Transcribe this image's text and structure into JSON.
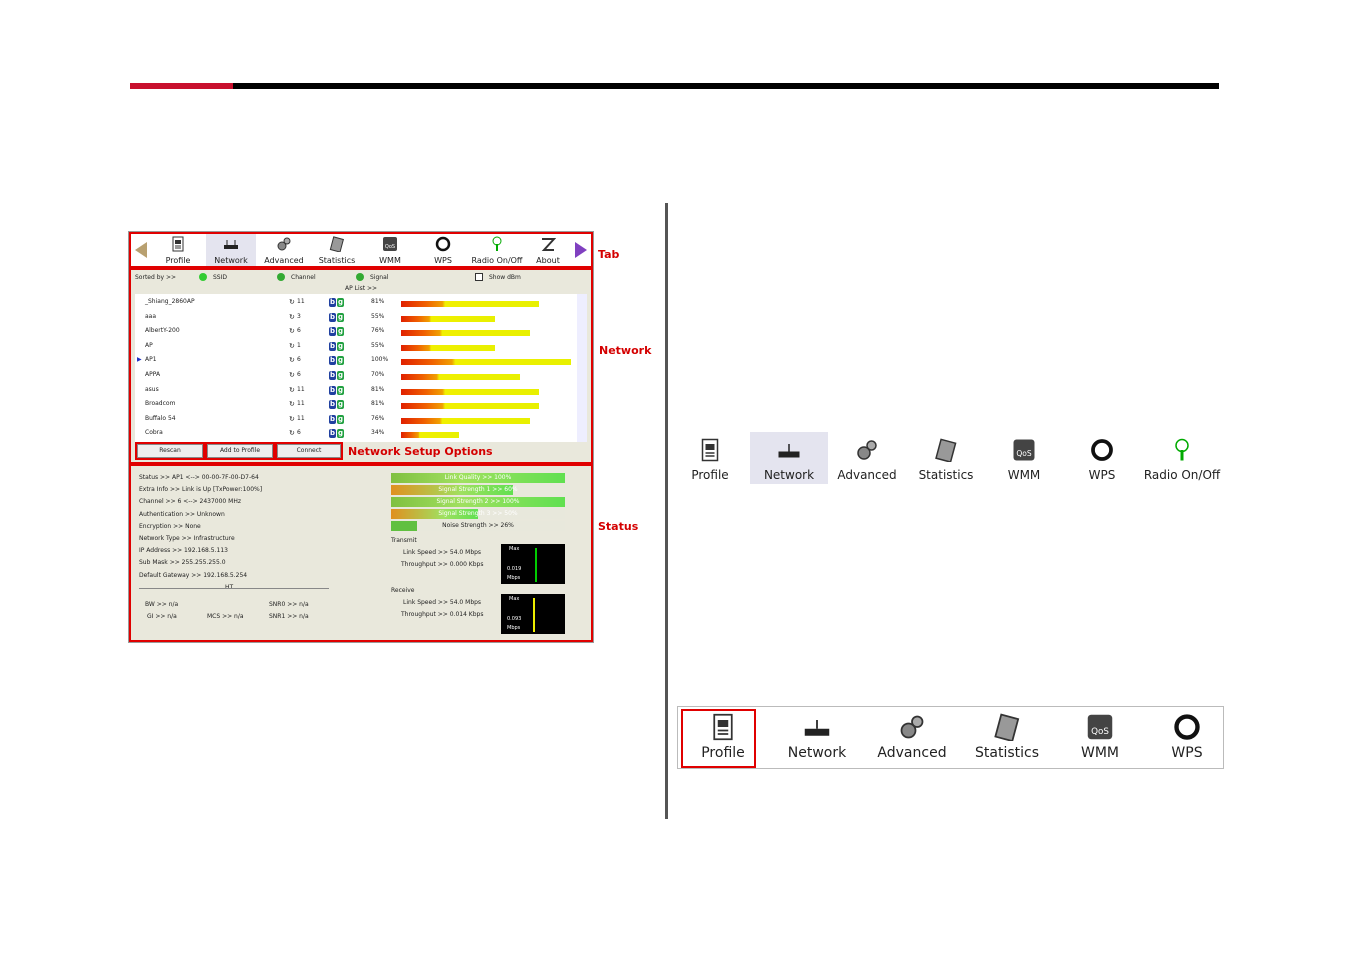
{
  "annotations": {
    "tab": "Tab",
    "network": "Network",
    "status": "Status",
    "setup": "Network Setup Options"
  },
  "tabs": [
    "Profile",
    "Network",
    "Advanced",
    "Statistics",
    "WMM",
    "WPS",
    "Radio On/Off",
    "About"
  ],
  "sort": {
    "label": "Sorted by >>",
    "ssid": "SSID",
    "channel": "Channel",
    "signal": "Signal",
    "show_dbm": "Show dBm",
    "ap_list": "AP List >>"
  },
  "aps": [
    {
      "name": "_Shiang_2860AP",
      "ch": "11",
      "pct": "81%",
      "fill": 0.81
    },
    {
      "name": "aaa",
      "ch": "3",
      "pct": "55%",
      "fill": 0.55
    },
    {
      "name": "AlbertY-200",
      "ch": "6",
      "pct": "76%",
      "fill": 0.76
    },
    {
      "name": "AP",
      "ch": "1",
      "pct": "55%",
      "fill": 0.55
    },
    {
      "name": "AP1",
      "ch": "6",
      "pct": "100%",
      "fill": 1.0
    },
    {
      "name": "APPA",
      "ch": "6",
      "pct": "70%",
      "fill": 0.7
    },
    {
      "name": "asus",
      "ch": "11",
      "pct": "81%",
      "fill": 0.81
    },
    {
      "name": "Broadcom",
      "ch": "11",
      "pct": "81%",
      "fill": 0.81
    },
    {
      "name": "Buffalo 54",
      "ch": "11",
      "pct": "76%",
      "fill": 0.76
    },
    {
      "name": "Cobra",
      "ch": "6",
      "pct": "34%",
      "fill": 0.34
    }
  ],
  "buttons": {
    "rescan": "Rescan",
    "add": "Add to Profile",
    "connect": "Connect"
  },
  "status": [
    "Status >> AP1 <--> 00-00-7F-00-D7-64",
    "Extra Info >> Link is Up [TxPower:100%]",
    "Channel >> 6 <--> 2437000 MHz",
    "Authentication >> Unknown",
    "Encryption >> None",
    "Network Type >> Infrastructure",
    "IP Address >> 192.168.5.113",
    "Sub Mask >> 255.255.255.0",
    "Default Gateway >> 192.168.5.254"
  ],
  "ht": {
    "label": "HT",
    "bw": "BW >> n/a",
    "gi": "GI >> n/a",
    "mcs": "MCS >> n/a",
    "snr0": "SNR0 >> n/a",
    "snr1": "SNR1 >> n/a"
  },
  "quality": [
    "Link Quality >> 100%",
    "Signal Strength 1 >> 60%",
    "Signal Strength 2 >> 100%",
    "Signal Strength 3 >> 50%",
    "Noise Strength >> 26%"
  ],
  "transmit": {
    "label": "Transmit",
    "speed": "Link Speed >> 54.0 Mbps",
    "thr": "Throughput >> 0.000 Kbps",
    "max": "Max",
    "val": "0.019",
    "unit": "Mbps"
  },
  "receive": {
    "label": "Receive",
    "speed": "Link Speed >> 54.0 Mbps",
    "thr": "Throughput >> 0.014 Kbps",
    "max": "Max",
    "val": "0.093",
    "unit": "Mbps"
  },
  "toolbar1": [
    "Profile",
    "Network",
    "Advanced",
    "Statistics",
    "WMM",
    "WPS",
    "Radio On/Off"
  ],
  "toolbar2": [
    "Profile",
    "Network",
    "Advanced",
    "Statistics",
    "WMM",
    "WPS"
  ]
}
